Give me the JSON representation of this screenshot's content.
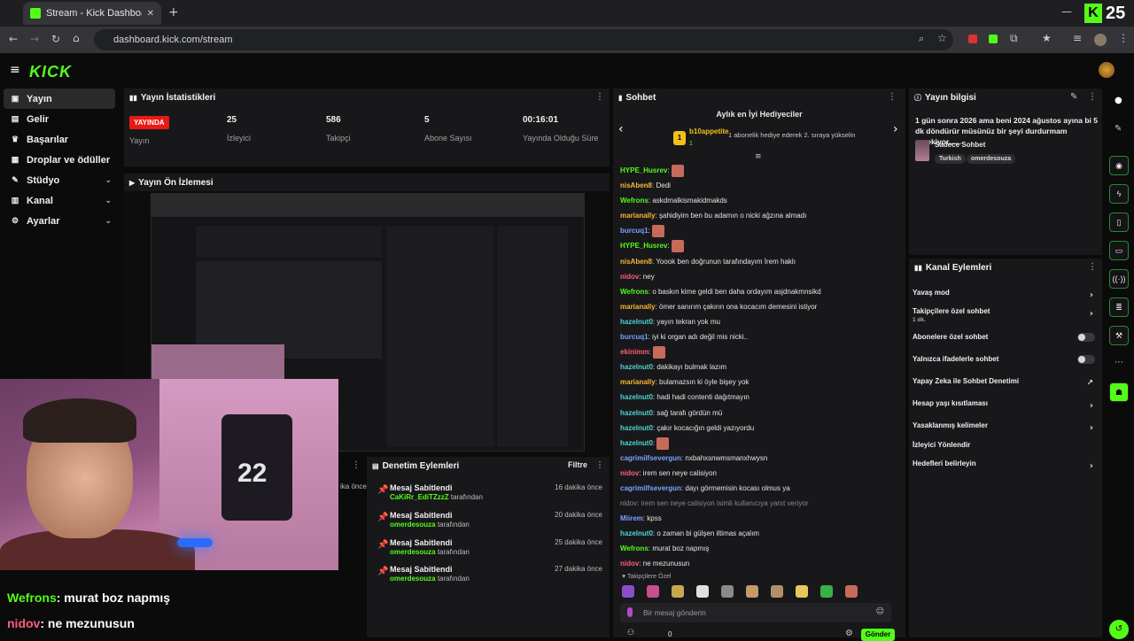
{
  "browser": {
    "tab_title": "Stream - Kick Dashboard",
    "url": "dashboard.kick.com/stream",
    "badge_number": "25"
  },
  "sidebar": {
    "items": [
      {
        "label": "Yayın",
        "icon": "broadcast-icon",
        "expandable": false
      },
      {
        "label": "Gelir",
        "icon": "revenue-icon",
        "expandable": false
      },
      {
        "label": "Başarılar",
        "icon": "trophy-icon",
        "expandable": false
      },
      {
        "label": "Droplar ve ödüller",
        "icon": "gift-icon",
        "expandable": false
      },
      {
        "label": "Stüdyo",
        "icon": "studio-icon",
        "expandable": true
      },
      {
        "label": "Kanal",
        "icon": "channel-icon",
        "expandable": true
      },
      {
        "label": "Ayarlar",
        "icon": "gear-icon",
        "expandable": true
      }
    ]
  },
  "stats": {
    "title": "Yayın İstatistikleri",
    "live_badge": "YAYINDA",
    "live_label": "Yayın",
    "viewers_value": "25",
    "viewers_label": "İzleyici",
    "followers_value": "586",
    "followers_label": "Takipçi",
    "subs_value": "5",
    "subs_label": "Abone Sayısı",
    "uptime_value": "00:16:01",
    "uptime_label": "Yayında Olduğu Süre"
  },
  "preview": {
    "title": "Yayın Ön İzlemesi"
  },
  "overlay_chat": [
    {
      "user": "Wefrons",
      "text": ": murat boz napmış",
      "color": "#53fc18"
    },
    {
      "user": "nidov",
      "text": ": ne mezunusun",
      "color": "#ff5c7a"
    }
  ],
  "mod_actions": {
    "title": "Denetim Eylemleri",
    "filter_label": "Filtre",
    "side_text": "ika önce",
    "rows": [
      {
        "action": "Mesaj Sabitlendi",
        "user": "CaKiRr_EdiTZzzZ",
        "suffix": "tarafından",
        "time": "16 dakika önce"
      },
      {
        "action": "Mesaj Sabitlendi",
        "user": "omerdesouza",
        "suffix": "tarafından",
        "time": "20 dakika önce"
      },
      {
        "action": "Mesaj Sabitlendi",
        "user": "omerdesouza",
        "suffix": "tarafından",
        "time": "25 dakika önce"
      },
      {
        "action": "Mesaj Sabitlendi",
        "user": "omerdesouza",
        "suffix": "tarafından",
        "time": "27 dakika önce"
      }
    ]
  },
  "chat": {
    "title": "Sohbet",
    "top_gifters_title": "Aylık en İyi Hediyeciler",
    "gifter_name": "b10appetite",
    "gifter_count": "1",
    "gifter_info": "1 abonelik hediye ederek 2. sıraya yükselin",
    "messages": [
      {
        "user": "HYPE_Husrev",
        "color": "#53fc18",
        "text": "",
        "emote": true
      },
      {
        "user": "nisAben8",
        "color": "#f7b733",
        "text": "Dedi",
        "emote": false
      },
      {
        "user": "Wefrons",
        "color": "#53fc18",
        "text": "askdmalkismakidmakds",
        "emote": false
      },
      {
        "user": "marianally",
        "color": "#f7b733",
        "text": "şahidiyim ben bu adamın o nicki ağzına almadı",
        "emote": false
      },
      {
        "user": "burcuq1",
        "color": "#7aa2ff",
        "text": "",
        "emote": true
      },
      {
        "user": "HYPE_Husrev",
        "color": "#53fc18",
        "text": "",
        "emote": true
      },
      {
        "user": "nisAben8",
        "color": "#f7b733",
        "text": "Yoook ben doğrunun tarafındayım İrem haklı",
        "emote": false
      },
      {
        "user": "nidov",
        "color": "#ff5c7a",
        "text": "ney",
        "emote": false
      },
      {
        "user": "Wefrons",
        "color": "#53fc18",
        "text": "o baskın kime geldi ben daha ordayım asjdnakmnsikd",
        "emote": false
      },
      {
        "user": "marianally",
        "color": "#f7b733",
        "text": "ömer sanırım çakırın ona kocacım demesini istiyor",
        "emote": false
      },
      {
        "user": "hazelnut0",
        "color": "#4fd2d2",
        "text": "yayın tekran yok mu",
        "emote": false
      },
      {
        "user": "burcuq1",
        "color": "#7aa2ff",
        "text": "iyi ki organ adı değil mis nicki..",
        "emote": false
      },
      {
        "user": "ekinimm",
        "color": "#ff5c7a",
        "text": "",
        "emote": true
      },
      {
        "user": "hazelnut0",
        "color": "#4fd2d2",
        "text": "dakikayı bulmak lazım",
        "emote": false
      },
      {
        "user": "marianally",
        "color": "#f7b733",
        "text": "bulamazsın ki öyle bişey yok",
        "emote": false
      },
      {
        "user": "hazelnut0",
        "color": "#4fd2d2",
        "text": "hadi hadi contenti dağıtmayın",
        "emote": false
      },
      {
        "user": "hazelnut0",
        "color": "#4fd2d2",
        "text": "sağ tarafı gördün mü",
        "emote": false
      },
      {
        "user": "hazelnut0",
        "color": "#4fd2d2",
        "text": "çakır kocacığın geldi yazıyordu",
        "emote": false
      },
      {
        "user": "hazelnut0",
        "color": "#4fd2d2",
        "text": "",
        "emote": true
      },
      {
        "user": "cagrimilfsevergun",
        "color": "#7aa2ff",
        "text": "nxbahxsnwmsmanxhwysn",
        "emote": false
      },
      {
        "user": "nidov",
        "color": "#ff5c7a",
        "text": "irem sen neye calisiyon",
        "emote": false
      },
      {
        "user": "cagrimilfsevergun",
        "color": "#7aa2ff",
        "text": "dayı görmemisin kocası olmus ya",
        "emote": false
      },
      {
        "user": "",
        "color": "#8a8a8a",
        "text": "nidov: irem sen neye calisiyon isimli kullanıcıya yanıt veriyor",
        "emote": false
      },
      {
        "user": "Miirem",
        "color": "#7aa2ff",
        "text": "kpss",
        "emote": false
      },
      {
        "user": "hazelnut0",
        "color": "#4fd2d2",
        "text": "o zaman bi gülşen iltimas açalım",
        "emote": false
      },
      {
        "user": "Wefrons",
        "color": "#53fc18",
        "text": "murat boz napmış",
        "emote": false
      },
      {
        "user": "nidov",
        "color": "#ff5c7a",
        "text": "ne mezunusun",
        "emote": false
      }
    ],
    "followers_only": "Takipçilere Özel",
    "input_placeholder": "Bir mesaj gönderin",
    "send_label": "Gönder",
    "footer_count": "0"
  },
  "stream_info": {
    "title": "Yayın bilgisi",
    "stream_title": "1 gün sonra 2026 ama beni 2024 ağustos ayına bi 5 dk döndürür müsünüz bir şeyi durdurmam gerekiyor......",
    "category": "Sadece Sohbet",
    "tags": [
      "Turkish",
      "omerdesouza"
    ]
  },
  "channel_actions": {
    "title": "Kanal Eylemleri",
    "rows": [
      {
        "label": "Yavaş mod",
        "sub": "",
        "control": "arrow"
      },
      {
        "label": "Takipçilere özel sohbet",
        "sub": "1 dk.",
        "control": "arrow"
      },
      {
        "label": "Abonelere özel sohbet",
        "sub": "",
        "control": "toggle"
      },
      {
        "label": "Yalnızca ifadelerle sohbet",
        "sub": "",
        "control": "toggle"
      },
      {
        "label": "Yapay Zeka ile Sohbet Denetimi",
        "sub": "",
        "control": "external"
      },
      {
        "label": "Hesap yaşı kısıtlaması",
        "sub": "",
        "control": "arrow"
      },
      {
        "label": "Yasaklanmış kelimeler",
        "sub": "",
        "control": "arrow"
      },
      {
        "label": "İzleyici Yönlendir",
        "sub": "",
        "control": "none"
      },
      {
        "label": "Hedefleri belirleyin",
        "sub": "",
        "control": "arrow"
      }
    ]
  },
  "colors": {
    "accent": "#53fc18",
    "live": "#e91916",
    "panel": "#18181b"
  }
}
